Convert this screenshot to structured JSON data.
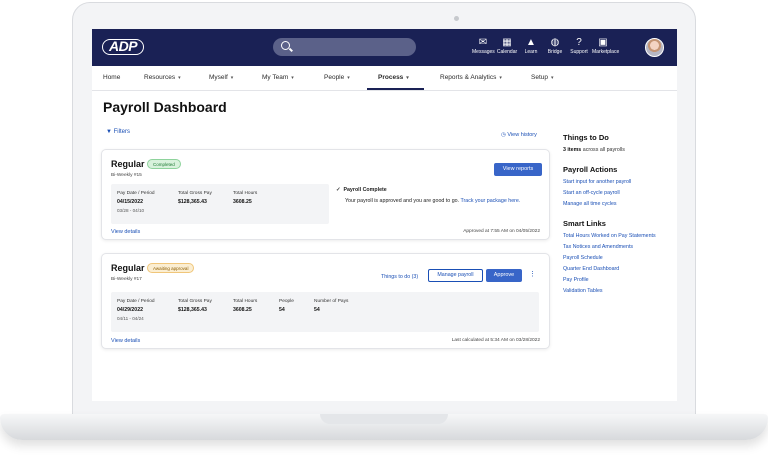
{
  "topbar": {
    "logo": "ADP",
    "icons": [
      {
        "name": "messages-icon",
        "glyph": "✉",
        "label": "Messages"
      },
      {
        "name": "calendar-icon",
        "glyph": "▦",
        "label": "Calendar"
      },
      {
        "name": "learn-icon",
        "glyph": "▲",
        "label": "Learn"
      },
      {
        "name": "bridge-icon",
        "glyph": "◍",
        "label": "Bridge"
      },
      {
        "name": "support-icon",
        "glyph": "?",
        "label": "Support"
      },
      {
        "name": "marketplace-icon",
        "glyph": "▣",
        "label": "Marketplace"
      }
    ]
  },
  "nav": {
    "items": [
      "Home",
      "Resources",
      "Myself",
      "My Team",
      "People",
      "Process",
      "Reports & Analytics",
      "Setup"
    ],
    "caret": "▾"
  },
  "page": {
    "title": "Payroll Dashboard",
    "filters": "Filters",
    "view_history": "View history"
  },
  "cards": [
    {
      "title": "Regular",
      "badge": "Completed",
      "subtitle": "Bi-Weekly #15",
      "columns": [
        {
          "header": "Pay Date / Period",
          "value": "04/15/2022",
          "sub": "03/28 - 04/10"
        },
        {
          "header": "Total Gross Pay",
          "value": "$128,365.43"
        },
        {
          "header": "Total Hours",
          "value": "3608.25"
        }
      ],
      "view_details": "View details",
      "button": "View reports",
      "status_title": "Payroll Complete",
      "status_msg": "Your payroll is approved and you are good to go.",
      "status_link": "Track your package here.",
      "meta": "Approved at 7:55 AM on 04/05/2022"
    },
    {
      "title": "Regular",
      "badge": "Awaiting approval",
      "subtitle": "Bi-Weekly #17",
      "columns": [
        {
          "header": "Pay Date / Period",
          "value": "04/29/2022",
          "sub": "04/11 - 04/24"
        },
        {
          "header": "Total Gross Pay",
          "value": "$128,365.43"
        },
        {
          "header": "Total Hours",
          "value": "3608.25"
        },
        {
          "header": "People",
          "value": "54"
        },
        {
          "header": "Number of Pays",
          "value": "54"
        }
      ],
      "view_details": "View details",
      "things_to_do": "Things to do (3)",
      "manage": "Manage payroll",
      "approve": "Approve",
      "more": "⋮",
      "meta": "Last calculated at 5:34 AM on 03/28/2022"
    }
  ],
  "sidebar": {
    "things_title": "Things to Do",
    "things_count": "3 items",
    "things_rest": "across all payrolls",
    "actions_title": "Payroll Actions",
    "actions": [
      "Start input for another payroll",
      "Start an off-cycle payroll",
      "Manage all time cycles"
    ],
    "links_title": "Smart Links",
    "links": [
      "Total Hours Worked on Pay Statements",
      "Tax Notices and Amendments",
      "Payroll Schedule",
      "Quarter End Dashboard",
      "Pay Profile",
      "Validation Tables"
    ]
  }
}
